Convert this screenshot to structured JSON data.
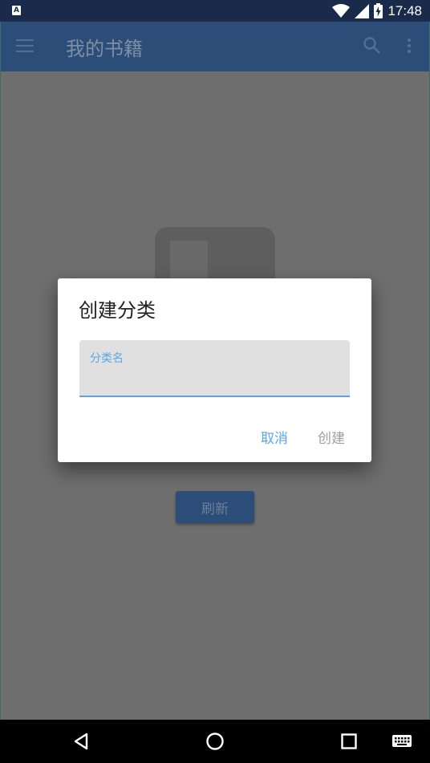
{
  "status_bar": {
    "app_icon_letter": "A",
    "time": "17:48",
    "icons": [
      "wifi-icon",
      "signal-icon",
      "battery-charging-icon"
    ]
  },
  "toolbar": {
    "title": "我的书籍",
    "icons": [
      "menu-icon",
      "search-icon",
      "more-vert-icon"
    ]
  },
  "content": {
    "refresh_label": "刷新"
  },
  "dialog": {
    "title": "创建分类",
    "field_label": "分类名",
    "field_value": "",
    "cancel_label": "取消",
    "create_label": "创建",
    "accent_color": "#5aa6e8"
  },
  "nav_bar": {
    "icons": [
      "back-icon",
      "home-icon",
      "recents-icon",
      "keyboard-icon"
    ]
  }
}
